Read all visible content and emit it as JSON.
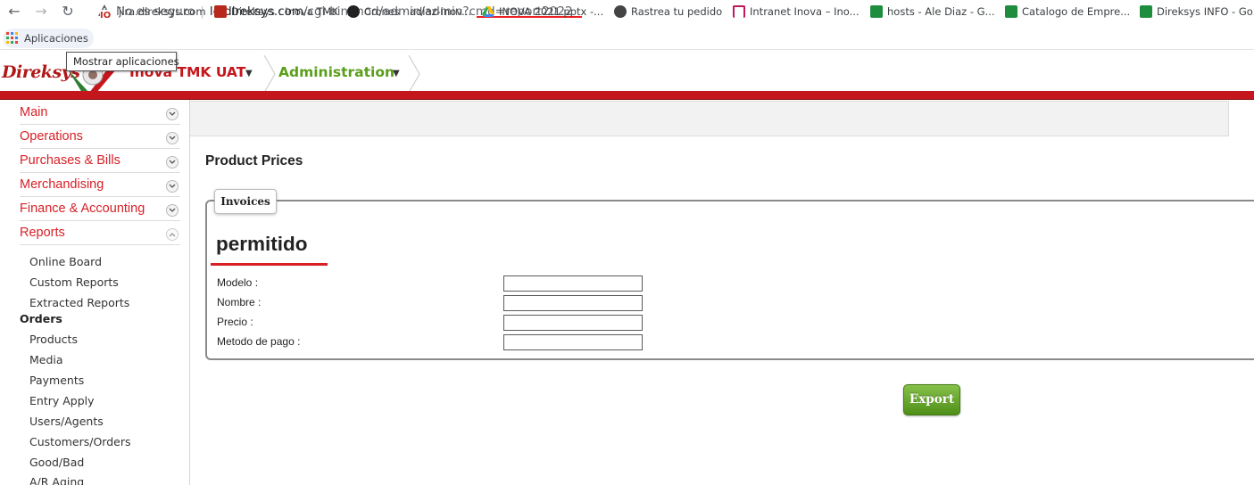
{
  "browser": {
    "security_label": "No es seguro",
    "url_host": "le.direksys.com",
    "url_path": "/cgi-bin/mod/admin/admin?cmd=report2022"
  },
  "bookmarks": [
    {
      "label": "Aplicaciones",
      "icon": "apps-grid-icon"
    },
    {
      "label": "jira.direksys.com",
      "icon": "jira-icon"
    },
    {
      "label": "Direksys : Inova TMK",
      "icon": "direksys-icon"
    },
    {
      "label": "Crones · adiaz-inov...",
      "icon": "github-icon"
    },
    {
      "label": "INOVA 2021.pptx -...",
      "icon": "drive-icon"
    },
    {
      "label": "Rastrea tu pedido",
      "icon": "globe-icon"
    },
    {
      "label": "Intranet Inova – Ino...",
      "icon": "intranet-icon"
    },
    {
      "label": "hosts - Ale Diaz - G...",
      "icon": "sheets-icon"
    },
    {
      "label": "Catalogo de Empre...",
      "icon": "sheets-icon"
    },
    {
      "label": "Direksys INFO - Go...",
      "icon": "sheets-icon"
    }
  ],
  "tooltip": "Mostrar aplicaciones",
  "header": {
    "logo_text": "Direksys",
    "app_name": "Inova TMK UAT",
    "section": "Administration"
  },
  "sidebar": {
    "sections": [
      "Main",
      "Operations",
      "Purchases & Bills",
      "Merchandising",
      "Finance & Accounting",
      "Reports"
    ],
    "report_items": [
      "Online Board",
      "Custom Reports",
      "Extracted Reports"
    ],
    "orders_heading": "Orders",
    "order_items": [
      "Products",
      "Media",
      "Payments",
      "Entry Apply",
      "Users/Agents",
      "Customers/Orders",
      "Good/Bad",
      "A/R Aging"
    ]
  },
  "main": {
    "page_title": "Product Prices",
    "tab_label": "Invoices",
    "section_heading": "permitido",
    "fields": [
      {
        "label": "Modelo :",
        "value": ""
      },
      {
        "label": "Nombre :",
        "value": ""
      },
      {
        "label": "Precio :",
        "value": ""
      },
      {
        "label": "Metodo de pago :",
        "value": ""
      }
    ],
    "export_label": "Export"
  },
  "colors": {
    "brand_red": "#c5161d",
    "admin_green": "#5a9e1a",
    "export_green": "#5e9f1f"
  }
}
